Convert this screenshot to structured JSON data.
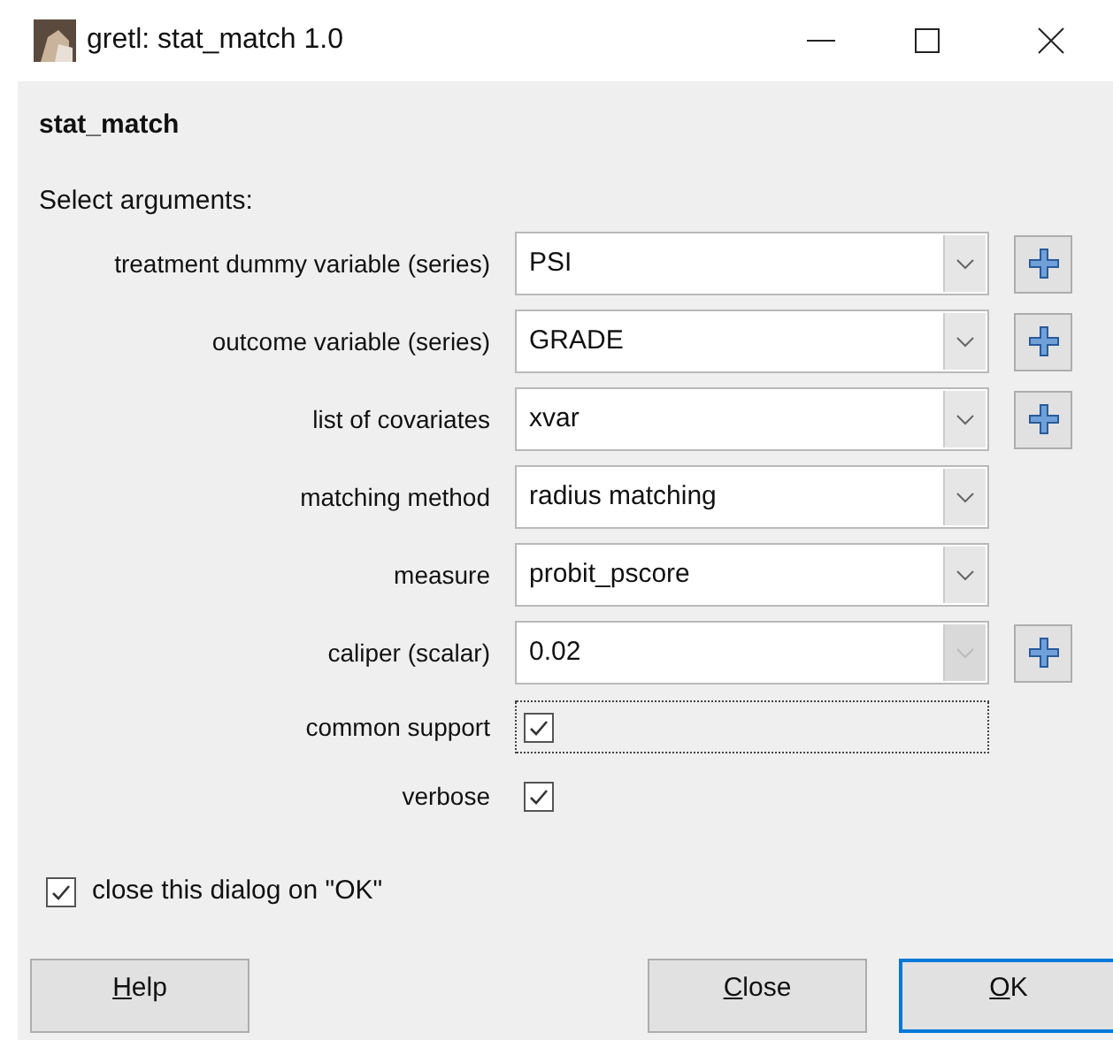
{
  "window": {
    "title": "gretl: stat_match 1.0"
  },
  "heading": "stat_match",
  "subheading": "Select arguments:",
  "rows": [
    {
      "kind": "combo",
      "label": "treatment dummy variable (series)",
      "value": "PSI",
      "disabled": false,
      "add_button": true
    },
    {
      "kind": "combo",
      "label": "outcome variable (series)",
      "value": "GRADE",
      "disabled": false,
      "add_button": true
    },
    {
      "kind": "combo",
      "label": "list of covariates",
      "value": "xvar",
      "disabled": false,
      "add_button": true
    },
    {
      "kind": "combo",
      "label": "matching method",
      "value": "radius matching",
      "disabled": false,
      "add_button": false
    },
    {
      "kind": "combo",
      "label": "measure",
      "value": "probit_pscore",
      "disabled": false,
      "add_button": false
    },
    {
      "kind": "combo",
      "label": "caliper (scalar)",
      "value": "0.02",
      "disabled": true,
      "add_button": true
    },
    {
      "kind": "checkbox",
      "label": "common support",
      "checked": true,
      "focused": true
    },
    {
      "kind": "checkbox",
      "label": "verbose",
      "checked": true,
      "focused": false
    }
  ],
  "close_on_ok": {
    "label": "close this dialog on \"OK\"",
    "checked": true
  },
  "buttons": [
    {
      "mnemonic": "H",
      "rest": "elp",
      "default": false
    },
    {
      "mnemonic": "C",
      "rest": "lose",
      "default": false
    },
    {
      "mnemonic": "O",
      "rest": "K",
      "default": true
    }
  ]
}
